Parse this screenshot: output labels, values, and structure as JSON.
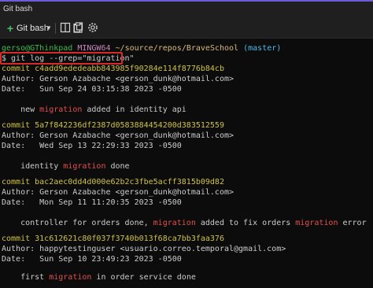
{
  "window": {
    "title": "Git bash"
  },
  "toolbar": {
    "new_tab_label": "Git bash",
    "icons": [
      "plus-icon",
      "chevron-down-icon",
      "split-pane-icon",
      "copy-icon",
      "paste-icon",
      "settings-icon"
    ]
  },
  "prompt": {
    "user_host": "gerso@GThinkpad",
    "shell": "MINGW64",
    "path": "~/source/repos/BraveSchool",
    "branch": "(master)"
  },
  "command": "$ git log --grep=\"migration\"",
  "commits": [
    {
      "hash": "commit c4add9ededeabb843985f90284e114f8776b84cb",
      "author": "Author: Gerson Azabache <gerson_dunk@hotmail.com>",
      "date": "Date:   Sun Sep 24 03:15:38 2023 -0500",
      "msg_pre": "    new ",
      "msg_hl": "migration",
      "msg_post": " added in identity api"
    },
    {
      "hash": "commit 5a7f842236df2387d0583884454200d383512559",
      "author": "Author: Gerson Azabache <gerson_dunk@hotmail.com>",
      "date": "Date:   Wed Sep 13 22:29:33 2023 -0500",
      "msg_pre": "    identity ",
      "msg_hl": "migration",
      "msg_post": " done"
    },
    {
      "hash": "commit bac2aec0dd4d000e62b2c3fbe5acff3815b09d82",
      "author": "Author: Gerson Azabache <gerson_dunk@hotmail.com>",
      "date": "Date:   Mon Sep 11 11:20:35 2023 -0500",
      "msg_pre": "    controller for orders done, ",
      "msg_hl": "migration",
      "msg_post": " added to fix orders ",
      "msg_hl2": "migration",
      "msg_post2": " error"
    },
    {
      "hash": "commit 31c612621c80f037f3740b013f68ca7bb3faa376",
      "author": "Author: happytestinguser <usuario.correo.temporal@gmail.com>",
      "date": "Date:   Sun Sep 10 23:49:23 2023 -0500",
      "msg_pre": "    first ",
      "msg_hl": "migration",
      "msg_post": " in order service done"
    }
  ],
  "colors": {
    "background": "#0c0c0c",
    "text": "#cccccc",
    "commit_hash": "#cfc24a",
    "highlight": "#e14f4f",
    "command_box": "#d62b2b",
    "accent": "#6b5cd6"
  }
}
